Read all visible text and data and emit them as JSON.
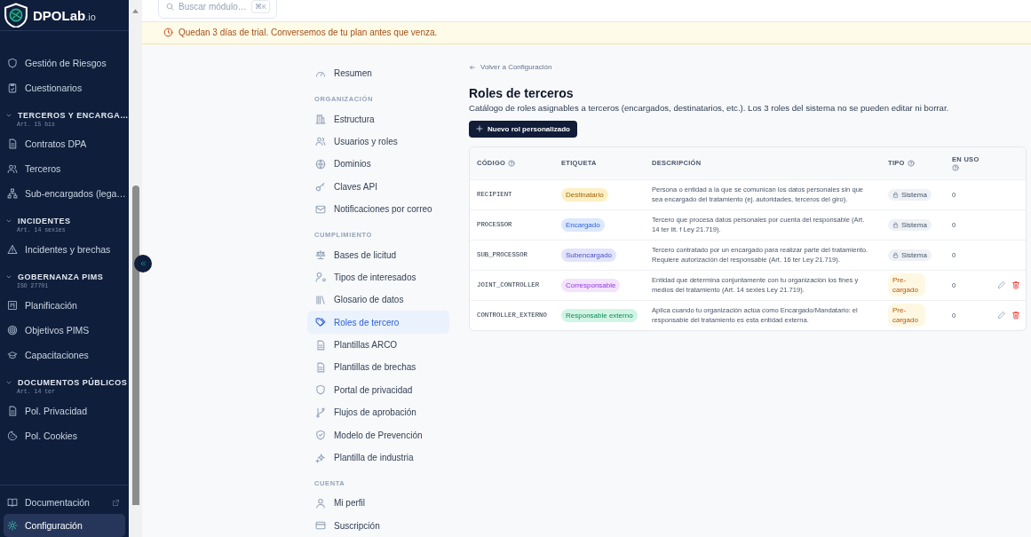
{
  "brand": {
    "name": "DPOLab",
    "suffix": ".io"
  },
  "sidebar": {
    "items": [
      {
        "kind": "item",
        "label": "Gestión de Riesgos",
        "selected": false
      },
      {
        "kind": "item",
        "label": "Cuestionarios",
        "selected": false
      },
      {
        "kind": "section",
        "label": "TERCEROS Y ENCARGA…",
        "sub": "Art. 15 bis",
        "expanded": true
      },
      {
        "kind": "item",
        "label": "Contratos DPA",
        "selected": false
      },
      {
        "kind": "item",
        "label": "Terceros",
        "selected": false
      },
      {
        "kind": "item",
        "label": "Sub-encargados (lega…",
        "selected": false
      },
      {
        "kind": "section",
        "label": "INCIDENTES",
        "sub": "Art. 14 sexies",
        "expanded": true
      },
      {
        "kind": "item",
        "label": "Incidentes y brechas",
        "selected": false
      },
      {
        "kind": "section",
        "label": "GOBERNANZA PIMS",
        "sub": "ISO 27701",
        "expanded": true
      },
      {
        "kind": "item",
        "label": "Planificación",
        "selected": false
      },
      {
        "kind": "item",
        "label": "Objetivos PIMS",
        "selected": false
      },
      {
        "kind": "item",
        "label": "Capacitaciones",
        "selected": false
      },
      {
        "kind": "section",
        "label": "DOCUMENTOS PÚBLICOS",
        "sub": "Art. 14 ter",
        "expanded": true
      },
      {
        "kind": "item",
        "label": "Pol. Privacidad",
        "selected": false
      },
      {
        "kind": "item",
        "label": "Pol. Cookies",
        "selected": false
      }
    ],
    "footer": [
      {
        "label": "Documentación",
        "external": true,
        "selected": false
      },
      {
        "label": "Configuración",
        "external": false,
        "selected": true
      }
    ]
  },
  "search": {
    "placeholder": "Buscar módulo…",
    "shortcut": "⌘K"
  },
  "banner": {
    "text": "Quedan 3 días de trial. Conversemos de tu plan antes que venza."
  },
  "settings_nav": [
    {
      "kind": "item",
      "label": "Resumen",
      "selected": false
    },
    {
      "kind": "heading",
      "label": "ORGANIZACIÓN"
    },
    {
      "kind": "item",
      "label": "Estructura",
      "selected": false
    },
    {
      "kind": "item",
      "label": "Usuarios y roles",
      "selected": false
    },
    {
      "kind": "item",
      "label": "Dominios",
      "selected": false
    },
    {
      "kind": "item",
      "label": "Claves API",
      "selected": false
    },
    {
      "kind": "item",
      "label": "Notificaciones por correo",
      "selected": false
    },
    {
      "kind": "heading",
      "label": "CUMPLIMIENTO"
    },
    {
      "kind": "item",
      "label": "Bases de licitud",
      "selected": false
    },
    {
      "kind": "item",
      "label": "Tipos de interesados",
      "selected": false
    },
    {
      "kind": "item",
      "label": "Glosario de datos",
      "selected": false
    },
    {
      "kind": "item",
      "label": "Roles de tercero",
      "selected": true
    },
    {
      "kind": "item",
      "label": "Plantillas ARCO",
      "selected": false
    },
    {
      "kind": "item",
      "label": "Plantillas de brechas",
      "selected": false
    },
    {
      "kind": "item",
      "label": "Portal de privacidad",
      "selected": false
    },
    {
      "kind": "item",
      "label": "Flujos de aprobación",
      "selected": false
    },
    {
      "kind": "item",
      "label": "Modelo de Prevención",
      "selected": false
    },
    {
      "kind": "item",
      "label": "Plantilla de industria",
      "selected": false
    },
    {
      "kind": "heading",
      "label": "CUENTA"
    },
    {
      "kind": "item",
      "label": "Mi perfil",
      "selected": false
    },
    {
      "kind": "item",
      "label": "Suscripción",
      "selected": false
    }
  ],
  "page": {
    "back_link": "Volver a Configuración",
    "title": "Roles de terceros",
    "subtitle": "Catálogo de roles asignables a terceros (encargados, destinatarios, etc.). Los 3 roles del sistema no se pueden editar ni borrar.",
    "new_button": "Nuevo rol personalizado"
  },
  "table": {
    "columns": [
      {
        "label": "CÓDIGO",
        "help": true
      },
      {
        "label": "ETIQUETA",
        "help": false
      },
      {
        "label": "DESCRIPCIÓN",
        "help": false
      },
      {
        "label": "TIPO",
        "help": true
      },
      {
        "label": "EN USO",
        "help": true
      }
    ],
    "rows": [
      {
        "code": "RECIPIENT",
        "label": "Destinatario",
        "color": "#fdf0c4",
        "description": "Persona o entidad a la que se comunican los datos personales sin que sea encargado del tratamiento (ej. autoridades, terceros del giro).",
        "type": "Sistema",
        "kind": "system",
        "in_use": "0",
        "editable": false
      },
      {
        "code": "PROCESSOR",
        "label": "Encargado",
        "color": "#dbe8fe",
        "description": "Tercero que procesa datos personales por cuenta del responsable (Art. 14 ter lit. f Ley 21.719).",
        "type": "Sistema",
        "kind": "system",
        "in_use": "0",
        "editable": false
      },
      {
        "code": "SUB_PROCESSOR",
        "label": "Subencargado",
        "color": "#e2e4fb",
        "description": "Tercero contratado por un encargado para realizar parte del tratamiento. Requiere autorización del responsable (Art. 16 ter Ley 21.719).",
        "type": "Sistema",
        "kind": "system",
        "in_use": "0",
        "editable": false
      },
      {
        "code": "JOINT_CONTROLLER",
        "label": "Corresponsable",
        "color": "#f3e3fc",
        "description": "Entidad que determina conjuntamente con tu organización los fines y medios del tratamiento (Art. 14 sexies Ley 21.719).",
        "type": "Pre-cargado",
        "kind": "preloaded",
        "in_use": "0",
        "editable": true
      },
      {
        "code": "CONTROLLER_EXTERNO",
        "label": "Responsable externo",
        "color": "#d1f5e4",
        "description": "Aplica cuando tu organización actúa como Encargado/Mandatario: el responsable del tratamiento es esta entidad externa.",
        "type": "Pre-cargado",
        "kind": "preloaded",
        "in_use": "0",
        "editable": true
      }
    ]
  }
}
